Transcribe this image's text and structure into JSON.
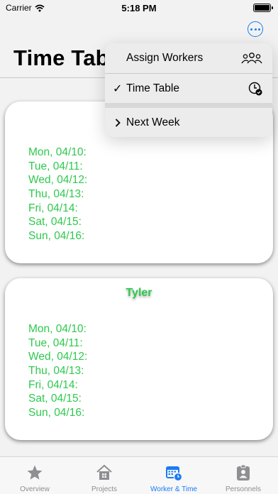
{
  "status_bar": {
    "carrier": "Carrier",
    "time": "5:18 PM"
  },
  "header": {
    "title": "Time Table",
    "more_icon": "ellipsis-circle-icon"
  },
  "menu": {
    "items": [
      {
        "label": "Assign Workers",
        "icon": "person-3-icon"
      },
      {
        "label": "Time Table",
        "icon": "clock-badge-checkmark-icon",
        "checked": true
      },
      {
        "label": "Next Week",
        "icon": "chevron-right-icon"
      }
    ]
  },
  "cards": [
    {
      "name": "",
      "days": [
        "Mon, 04/10:",
        "Tue, 04/11:",
        "Wed, 04/12:",
        "Thu, 04/13:",
        "Fri, 04/14:",
        "Sat, 04/15:",
        "Sun, 04/16:"
      ]
    },
    {
      "name": "Tyler",
      "days": [
        "Mon, 04/10:",
        "Tue, 04/11:",
        "Wed, 04/12:",
        "Thu, 04/13:",
        "Fri, 04/14:",
        "Sat, 04/15:",
        "Sun, 04/16:"
      ]
    }
  ],
  "tab_bar": {
    "tabs": [
      {
        "label": "Overview",
        "icon": "star-icon"
      },
      {
        "label": "Projects",
        "icon": "house-icon"
      },
      {
        "label": "Worker & Time",
        "icon": "calendar-clock-icon",
        "active": true
      },
      {
        "label": "Personnels",
        "icon": "person-badge-icon"
      }
    ]
  },
  "colors": {
    "accent": "#1a7cf2",
    "day_text": "#2ec94e",
    "tab_inactive": "#8e8e93"
  }
}
